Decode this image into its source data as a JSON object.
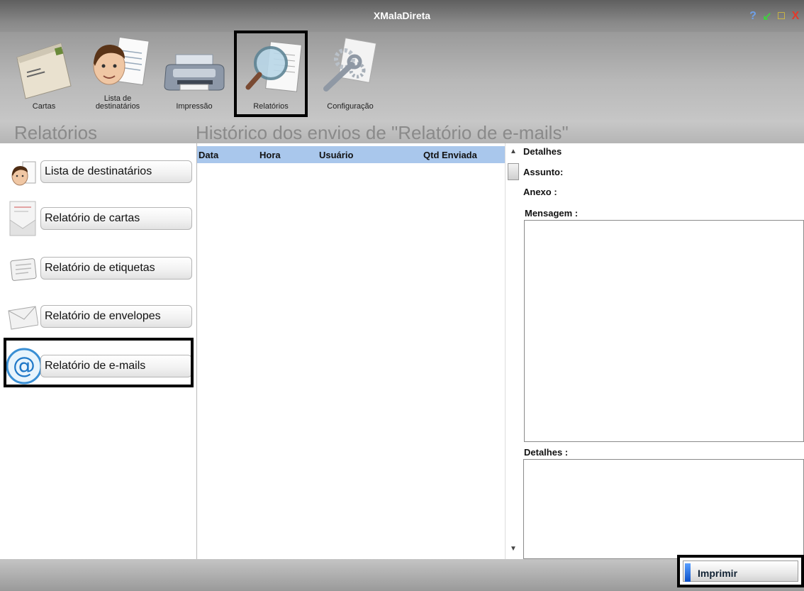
{
  "app": {
    "title": "XMalaDireta"
  },
  "window_controls": {
    "help": "?",
    "minimize": "↙",
    "maximize": "□",
    "close": "X"
  },
  "toolbar": {
    "items": [
      {
        "label": "Cartas",
        "icon": "letter-envelope-icon",
        "active": false
      },
      {
        "label": "Lista de destinatários",
        "icon": "person-list-icon",
        "active": false
      },
      {
        "label": "Impressão",
        "icon": "printer-icon",
        "active": false
      },
      {
        "label": "Relatórios",
        "icon": "magnifier-report-icon",
        "active": true
      },
      {
        "label": "Configuração",
        "icon": "gears-wrench-icon",
        "active": false
      }
    ]
  },
  "left_section": {
    "title": "Relatórios"
  },
  "main_section": {
    "title": "Histórico dos envios de \"Relatório de e-mails\""
  },
  "nav": {
    "items": [
      {
        "label": "Lista de destinatários",
        "icon": "person-icon"
      },
      {
        "label": "Relatório de cartas",
        "icon": "letter-icon"
      },
      {
        "label": "Relatório de etiquetas",
        "icon": "label-icon"
      },
      {
        "label": "Relatório de envelopes",
        "icon": "envelope-icon"
      },
      {
        "label": "Relatório de e-mails",
        "icon": "at-sign-icon",
        "selected": true
      }
    ]
  },
  "table": {
    "columns": [
      "Data",
      "Hora",
      "Usuário",
      "Qtd Enviada"
    ],
    "rows": []
  },
  "details": {
    "header": "Detalhes",
    "assunto_label": "Assunto:",
    "assunto_value": "",
    "anexo_label": "Anexo :",
    "anexo_value": "",
    "mensagem_label": "Mensagem :",
    "mensagem_value": "",
    "detalhes_label": "Detalhes :",
    "detalhes_value": ""
  },
  "actions": {
    "print_label": "Imprimir"
  }
}
